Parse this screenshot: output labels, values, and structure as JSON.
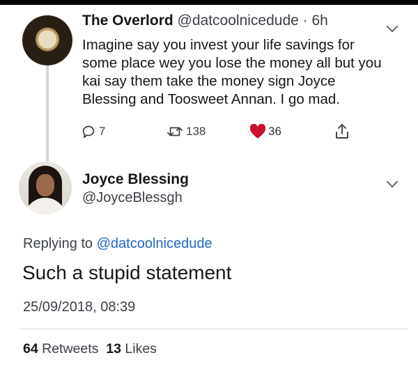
{
  "tweet1": {
    "display_name": "The Overlord",
    "handle": "@datcoolnicedude",
    "separator": " · ",
    "age": "6h",
    "text": "Imagine say you invest your life savings for some place wey you lose the money all but you kai say them take the money sign Joyce Blessing and Toosweet Annan. I go mad.",
    "replies": "7",
    "retweets": "138",
    "likes": "36",
    "icons": [
      "reply-icon",
      "retweet-icon",
      "heart-icon",
      "share-icon"
    ],
    "like_color": "#c8102e"
  },
  "tweet2": {
    "display_name": "Joyce Blessing",
    "handle": "@JoyceBlessgh",
    "replying_prefix": "Replying to ",
    "replying_to": "@datcoolnicedude",
    "text": "Such a stupid statement",
    "timestamp": "25/09/2018, 08:39",
    "retweets_count": "64",
    "retweets_label": "Retweets",
    "likes_count": "13",
    "likes_label": "Likes"
  },
  "colors": {
    "link": "#1f67c2",
    "muted": "#3b4046",
    "thread_line": "#cfd9de"
  }
}
